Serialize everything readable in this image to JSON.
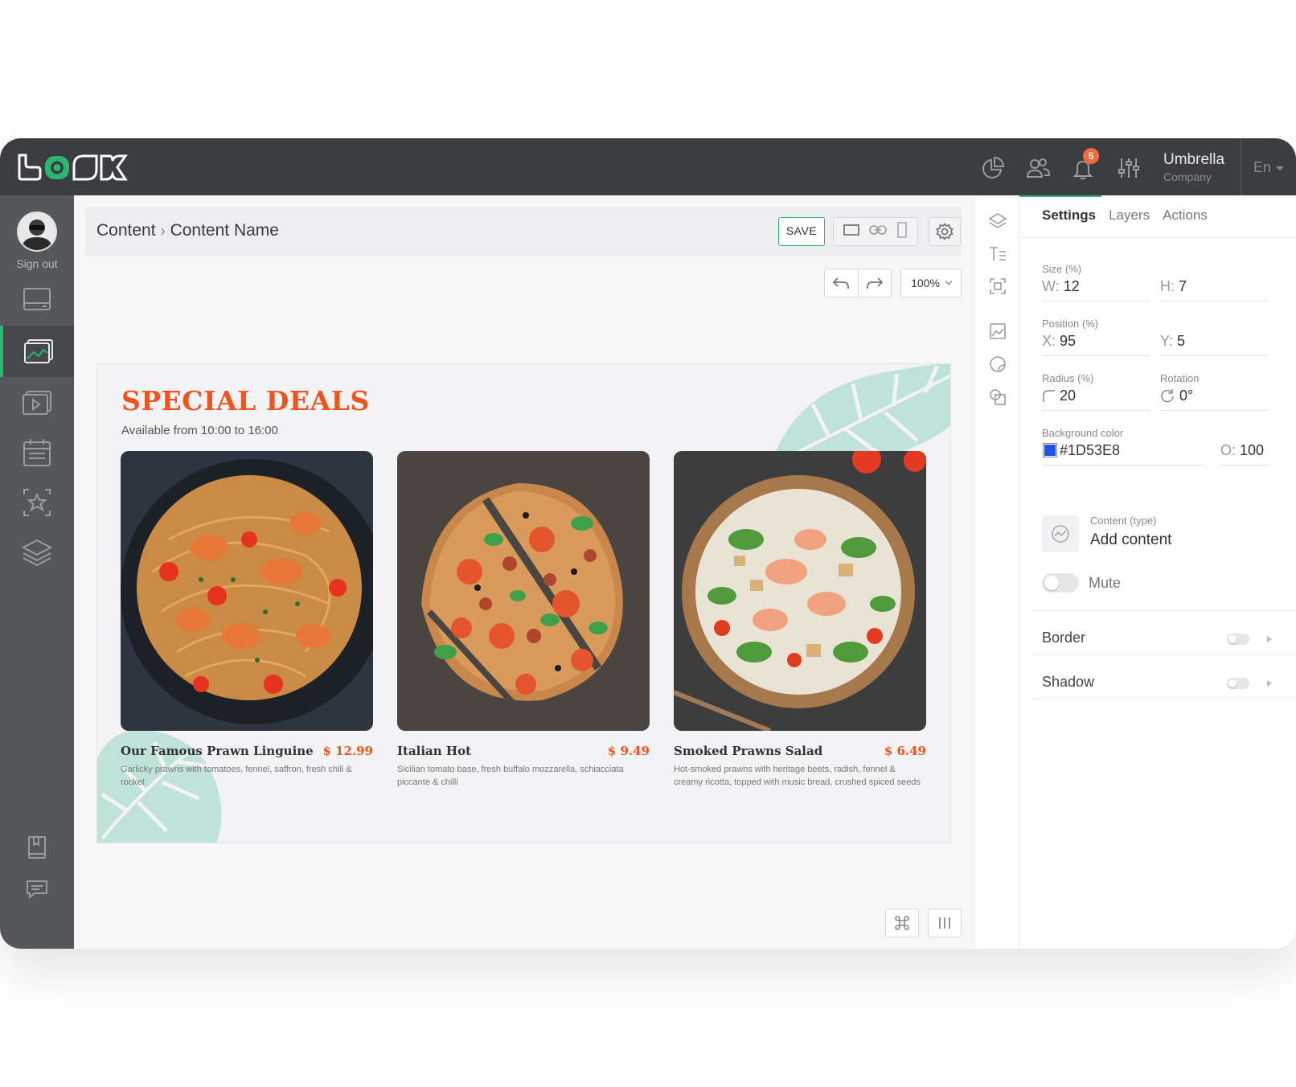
{
  "app": {
    "logo_text": "LOOK",
    "notifications_count": "5",
    "company_name": "Umbrella",
    "company_sub": "Company",
    "language": "En",
    "colors": {
      "accent": "#2bb673",
      "topbar": "#3c3d40",
      "sidebar": "#55575b",
      "brand_orange": "#f0541e"
    }
  },
  "topbar_icons": [
    "analytics-icon",
    "users-icon",
    "bell-icon",
    "sliders-icon"
  ],
  "sidebar": {
    "signout_label": "Sign out",
    "items": [
      {
        "icon": "display-icon",
        "active": false
      },
      {
        "icon": "media-icon",
        "active": true
      },
      {
        "icon": "video-icon",
        "active": false
      },
      {
        "icon": "calendar-icon",
        "active": false
      },
      {
        "icon": "star-icon",
        "active": false
      },
      {
        "icon": "layers-icon",
        "active": false
      }
    ],
    "bottom_items": [
      "book-icon",
      "chat-icon"
    ]
  },
  "header": {
    "breadcrumb_root": "Content",
    "breadcrumb_separator": "›",
    "breadcrumb_current": "Content Name",
    "save_label": "SAVE",
    "zoom_value": "100%"
  },
  "menu": {
    "title": "SPECIAL DEALS",
    "subtitle": "Available from 10:00 to 16:00",
    "items": [
      {
        "name": "Our Famous Prawn Linguine",
        "price": "$ 12.99",
        "description": "Garlicky prawns with tomatoes, fennel, saffron, fresh chili & rocket"
      },
      {
        "name": "Italian Hot",
        "price": "$ 9.49",
        "description": "Sicilian tomato base, fresh buffalo mozzarella, schiacciata piccante & chilli"
      },
      {
        "name": "Smoked Prawns Salad",
        "price": "$ 6.49",
        "description": "Hot-smoked prawns with heritage beets, radish, fennel & creamy ricotta, topped with music bread, crushed spiced seeds"
      }
    ]
  },
  "panel": {
    "tabs": [
      "Settings",
      "Layers",
      "Actions"
    ],
    "size_label": "Size (%)",
    "width_prefix": "W:",
    "width_value": "12",
    "height_prefix": "H:",
    "height_value": "7",
    "position_label": "Position (%)",
    "x_prefix": "X:",
    "x_value": "95",
    "y_prefix": "Y:",
    "y_value": "5",
    "radius_label": "Radius (%)",
    "radius_value": "20",
    "rotation_label": "Rotation",
    "rotation_value": "0°",
    "bg_label": "Background color",
    "bg_value": "#1D53E8",
    "opacity_prefix": "O:",
    "opacity_value": "100",
    "content_type_label": "Content (type)",
    "content_type_value": "Add content",
    "mute_label": "Mute",
    "border_label": "Border",
    "shadow_label": "Shadow"
  }
}
